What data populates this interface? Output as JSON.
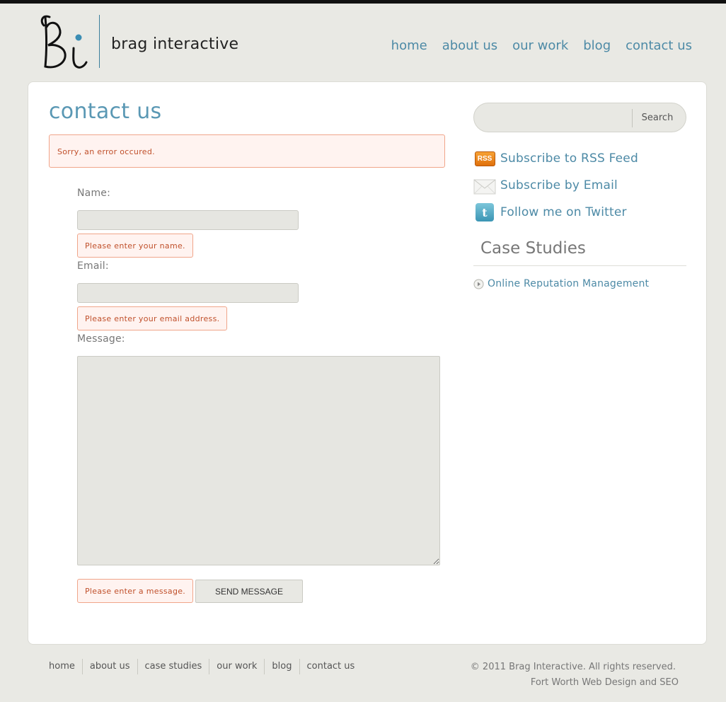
{
  "brand": {
    "name": "brag interactive",
    "accent": "#4d8aa6"
  },
  "nav": [
    {
      "label": "home"
    },
    {
      "label": "about us"
    },
    {
      "label": "our work"
    },
    {
      "label": "blog"
    },
    {
      "label": "contact us"
    }
  ],
  "page": {
    "title": "contact us",
    "form_error": "Sorry, an error occured."
  },
  "form": {
    "name": {
      "label": "Name:",
      "value": "",
      "error": "Please enter your name."
    },
    "email": {
      "label": "Email:",
      "value": "",
      "error": "Please enter your email address."
    },
    "message": {
      "label": "Message:",
      "value": "",
      "error": "Please enter a message."
    },
    "submit_label": "SEND MESSAGE"
  },
  "sidebar": {
    "search": {
      "value": "",
      "button_label": "Search"
    },
    "social": [
      {
        "label": "Subscribe to RSS Feed",
        "icon": "rss-icon",
        "icon_text": "RSS"
      },
      {
        "label": "Subscribe by Email",
        "icon": "envelope-icon"
      },
      {
        "label": "Follow me on Twitter",
        "icon": "twitter-icon",
        "icon_text": "t"
      }
    ],
    "case_studies": {
      "heading": "Case Studies",
      "items": [
        {
          "label": "Online Reputation Management"
        }
      ]
    }
  },
  "footer": {
    "nav": [
      {
        "label": "home"
      },
      {
        "label": "about us"
      },
      {
        "label": "case studies"
      },
      {
        "label": "our work"
      },
      {
        "label": "blog"
      },
      {
        "label": "contact us"
      }
    ],
    "copyright": "© 2011 Brag Interactive. All rights reserved.",
    "tagline": "Fort Worth Web Design and SEO"
  }
}
